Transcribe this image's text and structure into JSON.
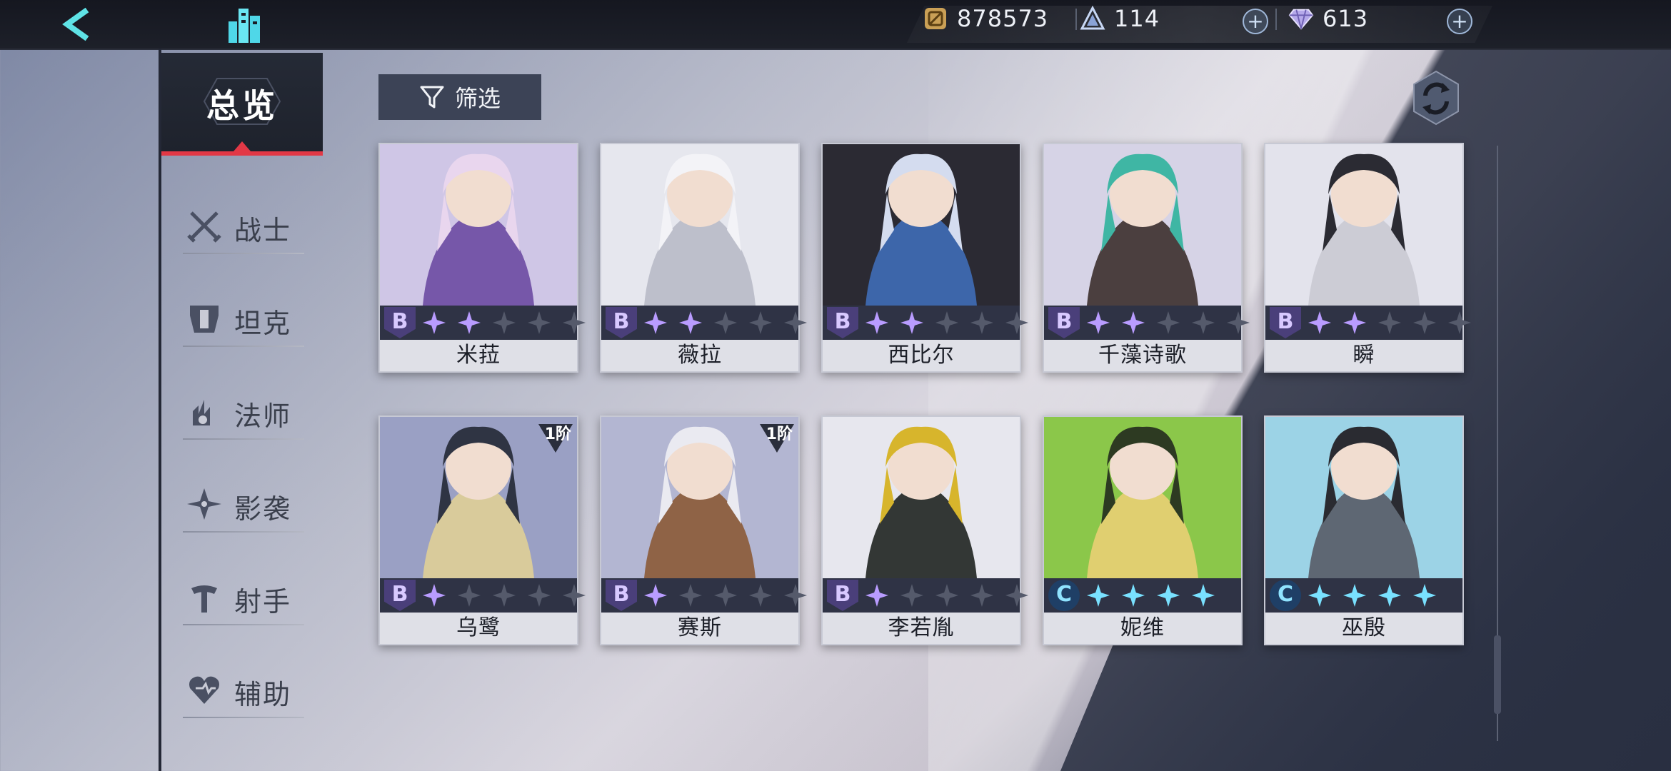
{
  "topbar": {
    "gold": "878573",
    "energy": "114",
    "crystal": "613"
  },
  "nav": {
    "overview": "总览",
    "items": [
      {
        "key": "warrior",
        "label": "战士"
      },
      {
        "key": "tank",
        "label": "坦克"
      },
      {
        "key": "mage",
        "label": "法师"
      },
      {
        "key": "assassin",
        "label": "影袭"
      },
      {
        "key": "shooter",
        "label": "射手"
      },
      {
        "key": "support",
        "label": "辅助"
      }
    ]
  },
  "filter": {
    "label": "筛选"
  },
  "cards": [
    {
      "name": "米菈",
      "rank": "B",
      "stars_on": 2,
      "stars_total": 5,
      "tier": "",
      "palette": [
        "#cfc6e6",
        "#6c4aa2",
        "#e9d6ee"
      ]
    },
    {
      "name": "薇拉",
      "rank": "B",
      "stars_on": 2,
      "stars_total": 5,
      "tier": "",
      "palette": [
        "#e6e7ee",
        "#b8bac6",
        "#f3f3f7"
      ]
    },
    {
      "name": "西比尔",
      "rank": "B",
      "stars_on": 2,
      "stars_total": 5,
      "tier": "",
      "palette": [
        "#2b2a33",
        "#3f6db7",
        "#d4dcef"
      ]
    },
    {
      "name": "千藻诗歌",
      "rank": "B",
      "stars_on": 2,
      "stars_total": 5,
      "tier": "",
      "palette": [
        "#d6d3e6",
        "#3c2f2c",
        "#3fb6a4"
      ]
    },
    {
      "name": "瞬",
      "rank": "B",
      "stars_on": 2,
      "stars_total": 5,
      "tier": "",
      "palette": [
        "#e3e3ec",
        "#c9c9d3",
        "#2b2b33"
      ]
    },
    {
      "name": "乌鹭",
      "rank": "B",
      "stars_on": 1,
      "stars_total": 5,
      "tier": "1阶",
      "palette": [
        "#9aa0c4",
        "#e0cf97",
        "#2f3443"
      ]
    },
    {
      "name": "赛斯",
      "rank": "B",
      "stars_on": 1,
      "stars_total": 5,
      "tier": "1阶",
      "palette": [
        "#b3b6d2",
        "#8b5a36",
        "#eaeaf1"
      ]
    },
    {
      "name": "李若胤",
      "rank": "B",
      "stars_on": 1,
      "stars_total": 5,
      "tier": "",
      "palette": [
        "#e7e7ee",
        "#1f2420",
        "#d7b52c"
      ]
    },
    {
      "name": "妮维",
      "rank": "C",
      "stars_on": 4,
      "stars_total": 4,
      "tier": "",
      "palette": [
        "#8bc74a",
        "#e9cf74",
        "#2d3a22"
      ]
    },
    {
      "name": "巫殷",
      "rank": "C",
      "stars_on": 4,
      "stars_total": 4,
      "tier": "",
      "palette": [
        "#9cd3e6",
        "#585b66",
        "#2a2b31"
      ]
    }
  ]
}
